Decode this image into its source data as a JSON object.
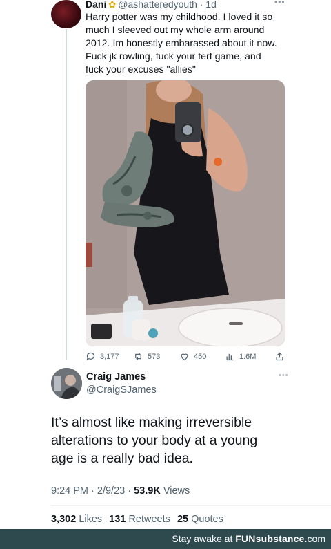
{
  "reply": {
    "name": "Dani",
    "badge_icon": "sunflower-icon",
    "handle_time": "@ashatteredyouth · 1d",
    "more_icon": "ellipsis-icon",
    "text_lines": [
      "Harry potter was my childhood. I loved it so",
      "much I sleeved out my whole arm around",
      "2012. Im honestly embarassed about it now.",
      "Fuck jk rowling, fuck your terf game, and",
      "fuck your excuses \"allies\""
    ],
    "actions": {
      "replies": "3,177",
      "retweets": "573",
      "likes": "450",
      "views": "1.6M"
    }
  },
  "tweet": {
    "name": "Craig James",
    "handle": "@CraigSJames",
    "text_lines": [
      "It’s almost like making irreversible",
      "alterations to your body at a young",
      "age is a really bad idea."
    ],
    "time_date": "9:24 PM · 2/9/23 · ",
    "views_count": "53.9K",
    "views_label": " Views",
    "stats": {
      "likes_count": "3,302",
      "likes_label": " Likes",
      "retweets_count": "131",
      "retweets_label": " Retweets",
      "quotes_count": "25",
      "quotes_label": " Quotes"
    }
  },
  "watermark": {
    "prefix": "Stay awake at ",
    "brand": "FUNsubstance",
    "suffix": ".com"
  },
  "colors": {
    "watermark_bar": "#2e4a4f",
    "muted_text": "#536471",
    "badge": "#e0a800"
  }
}
